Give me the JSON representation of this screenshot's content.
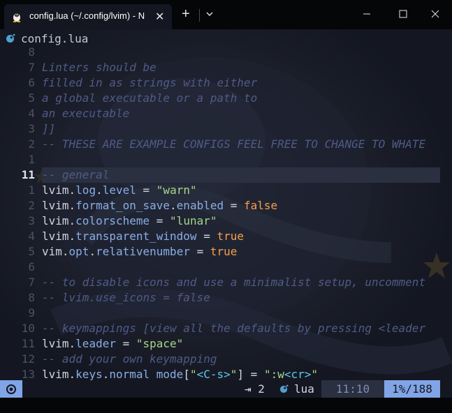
{
  "window": {
    "tab_title": "config.lua (~/.config/lvim) - N",
    "tab_close": "✕",
    "new_tab": "+",
    "icons": {
      "tab": "linux-penguin-icon",
      "dropdown": "chevron-down-icon",
      "minimize": "minimize-icon",
      "maximize": "maximize-icon",
      "close": "close-icon"
    }
  },
  "editor": {
    "filename": "config.lua",
    "lines": [
      {
        "num": "8",
        "tokens": []
      },
      {
        "num": "7",
        "tokens": [
          {
            "t": "Linters should be",
            "c": "comment"
          }
        ]
      },
      {
        "num": "6",
        "tokens": [
          {
            "t": "filled in as strings with either",
            "c": "comment"
          }
        ]
      },
      {
        "num": "5",
        "tokens": [
          {
            "t": "a global executable or a path to",
            "c": "comment"
          }
        ]
      },
      {
        "num": "4",
        "tokens": [
          {
            "t": "an executable",
            "c": "comment"
          }
        ]
      },
      {
        "num": "3",
        "tokens": [
          {
            "t": "]]",
            "c": "comment"
          }
        ]
      },
      {
        "num": "2",
        "tokens": [
          {
            "t": "-- THESE ARE EXAMPLE CONFIGS FEEL FREE TO CHANGE TO WHATE",
            "c": "comment"
          }
        ]
      },
      {
        "num": "1",
        "tokens": []
      },
      {
        "num": "11",
        "current": true,
        "tokens": [
          {
            "t": "-- general",
            "c": "comment"
          }
        ]
      },
      {
        "num": "1",
        "tokens": [
          {
            "t": "lvim",
            "c": "ident"
          },
          {
            "t": ".",
            "c": "op"
          },
          {
            "t": "log",
            "c": "prop"
          },
          {
            "t": ".",
            "c": "op"
          },
          {
            "t": "level",
            "c": "prop"
          },
          {
            "t": " = ",
            "c": "op"
          },
          {
            "t": "\"warn\"",
            "c": "string"
          }
        ]
      },
      {
        "num": "2",
        "tokens": [
          {
            "t": "lvim",
            "c": "ident"
          },
          {
            "t": ".",
            "c": "op"
          },
          {
            "t": "format_on_save",
            "c": "prop"
          },
          {
            "t": ".",
            "c": "op"
          },
          {
            "t": "enabled",
            "c": "prop"
          },
          {
            "t": " = ",
            "c": "op"
          },
          {
            "t": "false",
            "c": "bool"
          }
        ]
      },
      {
        "num": "3",
        "tokens": [
          {
            "t": "lvim",
            "c": "ident"
          },
          {
            "t": ".",
            "c": "op"
          },
          {
            "t": "colorscheme",
            "c": "prop"
          },
          {
            "t": " = ",
            "c": "op"
          },
          {
            "t": "\"lunar\"",
            "c": "string"
          }
        ]
      },
      {
        "num": "4",
        "tokens": [
          {
            "t": "lvim",
            "c": "ident"
          },
          {
            "t": ".",
            "c": "op"
          },
          {
            "t": "transparent_window",
            "c": "prop"
          },
          {
            "t": " = ",
            "c": "op"
          },
          {
            "t": "true",
            "c": "bool"
          }
        ]
      },
      {
        "num": "5",
        "tokens": [
          {
            "t": "vim",
            "c": "ident"
          },
          {
            "t": ".",
            "c": "op"
          },
          {
            "t": "opt",
            "c": "prop"
          },
          {
            "t": ".",
            "c": "op"
          },
          {
            "t": "relativenumber",
            "c": "prop"
          },
          {
            "t": " = ",
            "c": "op"
          },
          {
            "t": "true",
            "c": "bool"
          }
        ]
      },
      {
        "num": "6",
        "tokens": []
      },
      {
        "num": "7",
        "tokens": [
          {
            "t": "-- to disable icons and use a minimalist setup, uncomment",
            "c": "comment"
          }
        ]
      },
      {
        "num": "8",
        "tokens": [
          {
            "t": "-- lvim.use_icons = false",
            "c": "comment"
          }
        ]
      },
      {
        "num": "9",
        "tokens": []
      },
      {
        "num": "10",
        "tokens": [
          {
            "t": "-- keymappings [view all the defaults by pressing <leader",
            "c": "comment"
          }
        ]
      },
      {
        "num": "11",
        "tokens": [
          {
            "t": "lvim",
            "c": "ident"
          },
          {
            "t": ".",
            "c": "op"
          },
          {
            "t": "leader",
            "c": "prop"
          },
          {
            "t": " = ",
            "c": "op"
          },
          {
            "t": "\"space\"",
            "c": "string"
          }
        ]
      },
      {
        "num": "12",
        "tokens": [
          {
            "t": "-- add your own keymapping",
            "c": "comment"
          }
        ]
      },
      {
        "num": "13",
        "tokens": [
          {
            "t": "lvim",
            "c": "ident"
          },
          {
            "t": ".",
            "c": "op"
          },
          {
            "t": "keys",
            "c": "prop"
          },
          {
            "t": ".",
            "c": "op"
          },
          {
            "t": "normal_mode",
            "c": "prop"
          },
          {
            "t": "[",
            "c": "op"
          },
          {
            "t": "\"",
            "c": "string"
          },
          {
            "t": "<C-s>",
            "c": "special"
          },
          {
            "t": "\"",
            "c": "string"
          },
          {
            "t": "] = ",
            "c": "op"
          },
          {
            "t": "\":w",
            "c": "string"
          },
          {
            "t": "<cr>",
            "c": "special"
          },
          {
            "t": "\"",
            "c": "string"
          }
        ]
      }
    ]
  },
  "statusline": {
    "indent": "⇥ 2",
    "filetype": "lua",
    "position": "11:10",
    "percent": "1%/188"
  },
  "colors": {
    "background": "#141721",
    "accent": "#80a4e6",
    "comment": "#4f5b86",
    "string": "#a7d68a",
    "boolean": "#f6a04d",
    "property": "#89aee6"
  }
}
